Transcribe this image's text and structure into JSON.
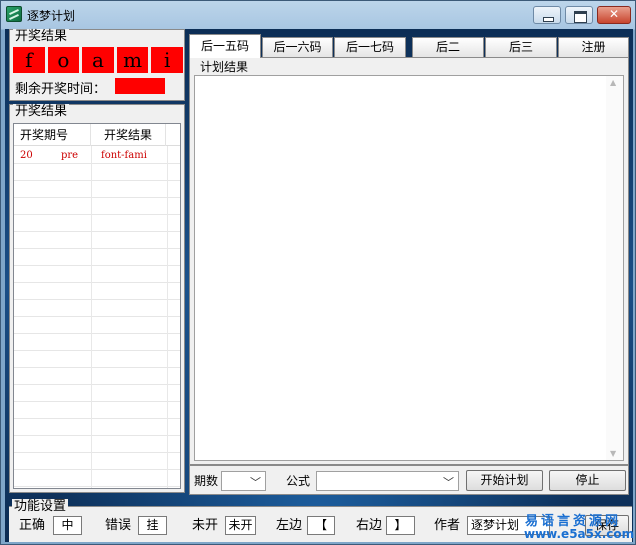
{
  "window": {
    "title": "逐梦计划"
  },
  "draw_results": {
    "group_title": "开奖结果",
    "balls": [
      "f",
      "o",
      "a",
      "m",
      "i"
    ],
    "remaining_label": "剩余开奖时间："
  },
  "result_list": {
    "group_title": "开奖结果",
    "columns": [
      "开奖期号",
      "开奖结果"
    ],
    "rows": [
      {
        "a": "20",
        "b": "pre",
        "c": "font-fami"
      }
    ]
  },
  "tabs": {
    "items": [
      "后一五码",
      "后一六码",
      "后一七码",
      "后二",
      "后三",
      "注册"
    ],
    "active_index": 0
  },
  "plan": {
    "title": "计划结果",
    "text": ""
  },
  "controls": {
    "period_label": "期数",
    "period_value": "",
    "formula_label": "公式",
    "formula_value": "",
    "start_label": "开始计划",
    "stop_label": "停止"
  },
  "function_settings": {
    "title": "功能设置",
    "correct_label": "正确",
    "correct_value": "中",
    "wrong_label": "错误",
    "wrong_value": "挂",
    "unopened_label": "未开",
    "unopened_value": "未开",
    "left_label": "左边",
    "left_value": "【",
    "right_label": "右边",
    "right_value": "】",
    "author_label": "作者",
    "author_value": "逐梦计划",
    "save_label": "保存"
  },
  "watermark": {
    "line1": "易语言资源网",
    "line2": "www.e5a5x.com"
  },
  "colors": {
    "ball_red": "#ff0000",
    "result_text_red": "#cc0000",
    "watermark_blue": "#1a6fd1"
  }
}
